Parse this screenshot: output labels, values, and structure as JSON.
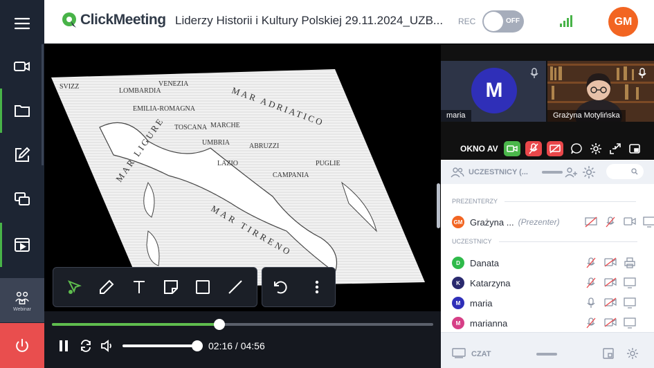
{
  "header": {
    "logo_text": "ClickMeeting",
    "title": "Liderzy Historii i Kultury Polskiej 29.11.2024_UZB...",
    "rec_label": "REC",
    "rec_toggle": "OFF",
    "user_initials": "GM",
    "brand_color": "#48b348",
    "avatar_color": "#f26522"
  },
  "sidebar": {
    "items": [
      {
        "icon": "menu-icon"
      },
      {
        "icon": "camera-icon"
      },
      {
        "icon": "folder-icon"
      },
      {
        "icon": "edit-icon"
      },
      {
        "icon": "screen-share-icon"
      },
      {
        "icon": "media-icon"
      }
    ],
    "webinar_label": "Webinar",
    "exit_icon": "power-icon",
    "exit_color": "#e94e4e"
  },
  "player": {
    "progress": 0.44,
    "volume": 1.0,
    "time": "02:16 / 04:56"
  },
  "map_labels": [
    "SVIZZ",
    "LOMBARDIA",
    "VENEZIA",
    "EMILIA-ROMAGNA",
    "TOSCANA",
    "MARCHE",
    "UMBRIA",
    "LAZIO",
    "ABRUZZI",
    "CAMPANIA",
    "PUGLIE",
    "MAR LIGURE",
    "MAR TIRRENO",
    "MAR ADRIATICO"
  ],
  "videos": [
    {
      "name": "maria",
      "initial": "M"
    },
    {
      "name": "Grażyna Motylińska"
    }
  ],
  "okno": {
    "label": "OKNO AV"
  },
  "participants": {
    "header_label": "UCZESTNICY (...",
    "presenters_label": "PREZENTERZY",
    "attendees_label": "UCZESTNICY",
    "presenters": [
      {
        "initials": "GM",
        "name": "Grażyna ...",
        "role": "(Prezenter)",
        "color": "#f26522"
      }
    ],
    "attendees": [
      {
        "initials": "D",
        "name": "Danata",
        "color": "#2fba4a"
      },
      {
        "initials": "K",
        "name": "Katarzyna",
        "color": "#2a2a6e"
      },
      {
        "initials": "M",
        "name": "maria",
        "color": "#2f2fb8"
      },
      {
        "initials": "M",
        "name": "marianna",
        "color": "#d63f86"
      }
    ]
  },
  "chat": {
    "label": "CZAT"
  }
}
